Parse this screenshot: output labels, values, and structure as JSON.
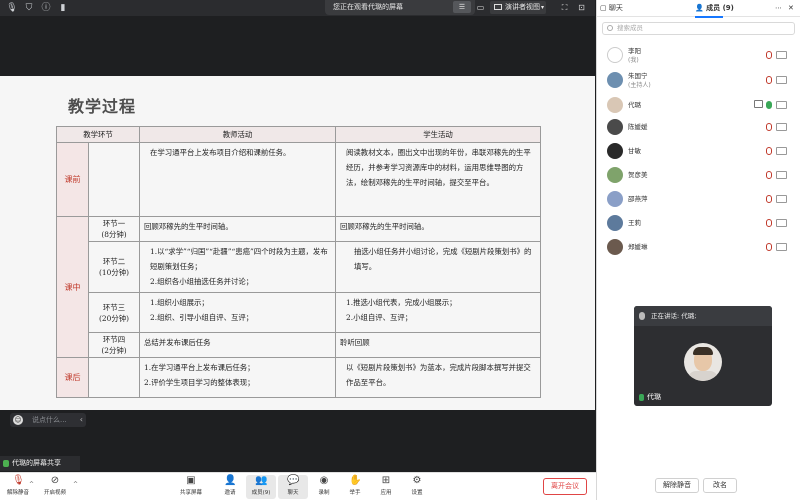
{
  "topbar": {
    "notice": "您正在观看代璐的屏幕",
    "presenter_view": "演讲者视图"
  },
  "slide": {
    "title": "教学过程",
    "headers": [
      "教学环节",
      "教师活动",
      "学生活动"
    ],
    "stage_pre": "课前",
    "stage_in": "课中",
    "stage_post": "课后",
    "pre_teacher": "在学习通平台上发布项目介绍和课前任务。",
    "pre_student": "阅读教材文本，圈出文中出现的年份，串联邓稼先的生平经历，并参考学习资源库中的材料，运用思维导图的方法，绘制邓稼先的生平时间轴，提交至平台。",
    "seg1_name": "环节一",
    "seg1_time": "(8分钟)",
    "seg1_teacher": "回顾邓稼先的生平时间轴。",
    "seg1_student": "回顾邓稼先的生平时间轴。",
    "seg2_name": "环节二",
    "seg2_time": "(10分钟)",
    "seg2_teacher_1": "1.以“求学”“归国”“赴疆”“患癌”四个时段为主题，发布短剧策划任务；",
    "seg2_teacher_2": "2.组织各小组抽选任务并讨论；",
    "seg2_student": "抽选小组任务并小组讨论，完成《短剧片段策划书》的填写。",
    "seg3_name": "环节三",
    "seg3_time": "(20分钟)",
    "seg3_teacher_1": "1.组织小组展示；",
    "seg3_teacher_2": "2.组织、引导小组自评、互评；",
    "seg3_student_1": "1.推选小组代表，完成小组展示；",
    "seg3_student_2": "2.小组自评、互评；",
    "seg4_name": "环节四",
    "seg4_time": "(2分钟)",
    "seg4_teacher": "总结并发布课后任务",
    "seg4_student": "聆听回顾",
    "post_teacher_1": "1.在学习通平台上发布课后任务；",
    "post_teacher_2": "2.评价学生项目学习的整体表现；",
    "post_student": "以《短剧片段策划书》为蓝本，完成片段脚本撰写并提交作品至平台。"
  },
  "chat_input": {
    "placeholder": "说点什么..."
  },
  "share_label": "代璐的屏幕共享",
  "sidebar": {
    "tab_chat": "聊天",
    "tab_members": "成员 (9)",
    "search_placeholder": "搜索成员",
    "members": [
      {
        "name": "李阳",
        "role": "(我)"
      },
      {
        "name": "朱国宁",
        "role": "(主持人)"
      },
      {
        "name": "代璐",
        "role": ""
      },
      {
        "name": "陈媛媛",
        "role": ""
      },
      {
        "name": "甘敏",
        "role": ""
      },
      {
        "name": "贺彦美",
        "role": ""
      },
      {
        "name": "邵燕萍",
        "role": ""
      },
      {
        "name": "王莉",
        "role": ""
      },
      {
        "name": "郑媛琳",
        "role": ""
      }
    ],
    "speaker_header": "正在讲话: 代璐;",
    "speaker_name": "代璐",
    "mute_all": "解除静音",
    "rename": "改名"
  },
  "toolbar": {
    "mic": "解除静音",
    "video": "开启视频",
    "share": "共享屏幕",
    "invite": "邀请",
    "members": "成员(9)",
    "chat": "聊天",
    "record": "录制",
    "raise": "举手",
    "apps": "应用",
    "settings": "设置",
    "leave": "离开会议"
  },
  "colors": {
    "accent": "#1677ff",
    "danger": "#e04545",
    "stage_text": "#c0392b",
    "stage_bg": "#f4e6e6"
  }
}
